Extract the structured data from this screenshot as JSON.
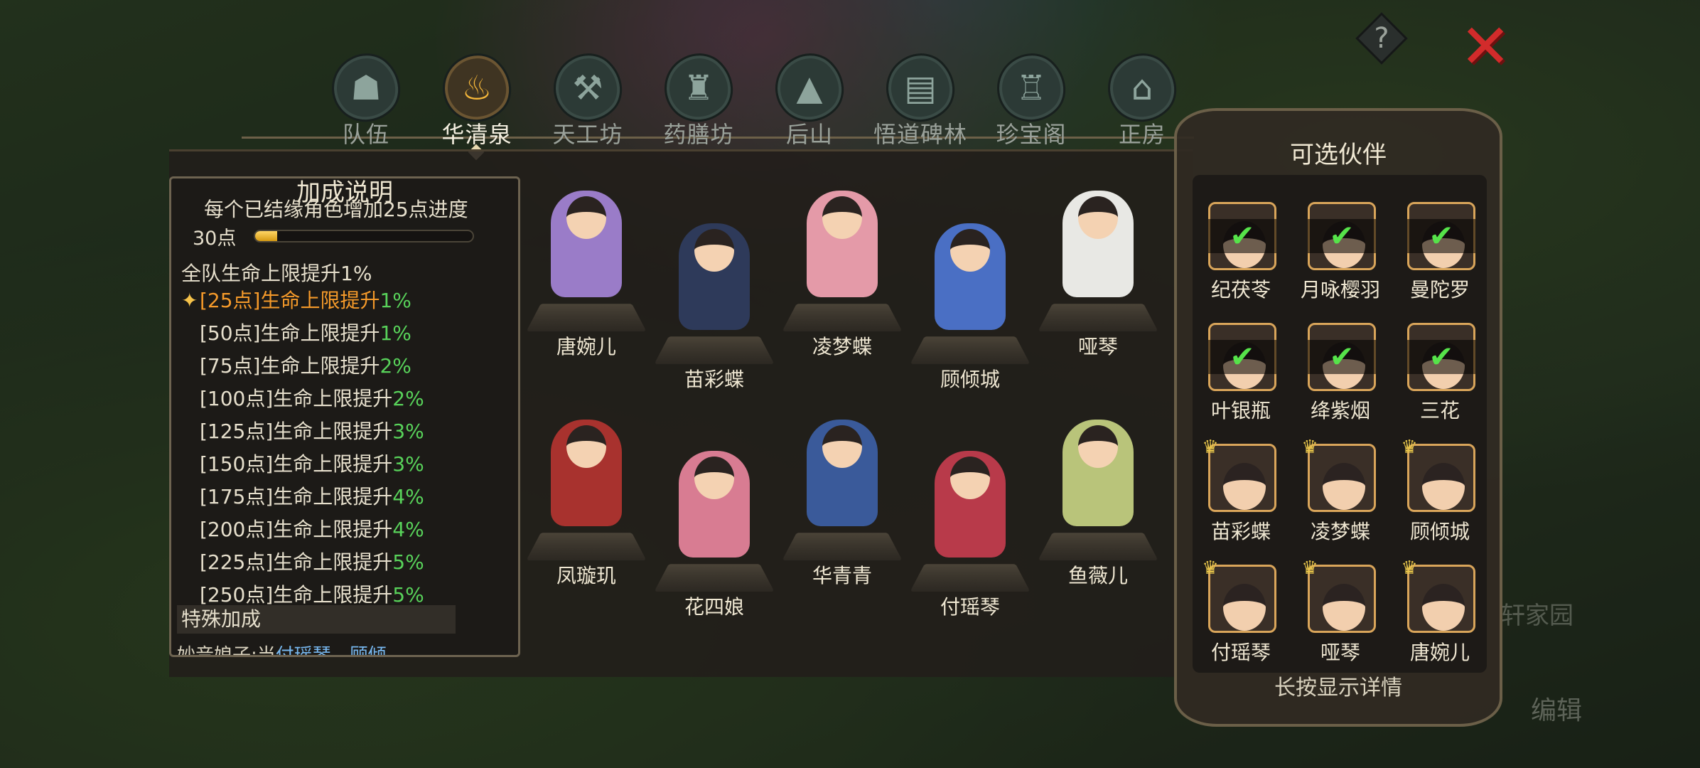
{
  "tabs": [
    {
      "label": "队伍",
      "glyph": "☗",
      "icon": "team-icon"
    },
    {
      "label": "华清泉",
      "glyph": "♨",
      "icon": "hot-spring-icon"
    },
    {
      "label": "天工坊",
      "glyph": "⚒",
      "icon": "workshop-icon"
    },
    {
      "label": "药膳坊",
      "glyph": "♜",
      "icon": "kitchen-icon"
    },
    {
      "label": "后山",
      "glyph": "▲",
      "icon": "mountain-icon"
    },
    {
      "label": "悟道碑林",
      "glyph": "▤",
      "icon": "stele-icon"
    },
    {
      "label": "珍宝阁",
      "glyph": "♖",
      "icon": "treasure-pavilion-icon"
    },
    {
      "label": "正房",
      "glyph": "⌂",
      "icon": "main-house-icon"
    }
  ],
  "active_tab": "华清泉",
  "help_glyph": "?",
  "close_glyph": "✕",
  "info": {
    "title": "加成说明",
    "description": "每个已结缘角色增加25点进度",
    "progress_label": "30点",
    "progress_fraction": 0.1,
    "team_bonus": "全队生命上限提升1%",
    "bonuses": [
      {
        "text": "[25点]生命上限提升",
        "pct": "1%",
        "active": true
      },
      {
        "text": "[50点]生命上限提升",
        "pct": "1%",
        "active": false
      },
      {
        "text": "[75点]生命上限提升",
        "pct": "2%",
        "active": false
      },
      {
        "text": "[100点]生命上限提升",
        "pct": "2%",
        "active": false
      },
      {
        "text": "[125点]生命上限提升",
        "pct": "3%",
        "active": false
      },
      {
        "text": "[150点]生命上限提升",
        "pct": "3%",
        "active": false
      },
      {
        "text": "[175点]生命上限提升",
        "pct": "4%",
        "active": false
      },
      {
        "text": "[200点]生命上限提升",
        "pct": "4%",
        "active": false
      },
      {
        "text": "[225点]生命上限提升",
        "pct": "5%",
        "active": false
      },
      {
        "text": "[250点]生命上限提升",
        "pct": "5%",
        "active": false
      }
    ],
    "special_title": "特殊加成",
    "special_text_a": "妙音娘子:当",
    "special_text_hl": "付瑶琴、顾倾",
    "star_glyph": "✦"
  },
  "characters": [
    {
      "name": "唐婉儿",
      "robe": "#9a7cc8"
    },
    {
      "name": "苗彩蝶",
      "robe": "#2e3a5a"
    },
    {
      "name": "凌梦蝶",
      "robe": "#e49aa8"
    },
    {
      "name": "顾倾城",
      "robe": "#4a6fc4"
    },
    {
      "name": "哑琴",
      "robe": "#e8e8e4"
    },
    {
      "name": "凤璇玑",
      "robe": "#a8322e"
    },
    {
      "name": "花四娘",
      "robe": "#d87c92"
    },
    {
      "name": "华青青",
      "robe": "#3a5a9a"
    },
    {
      "name": "付瑶琴",
      "robe": "#b83a4a"
    },
    {
      "name": "鱼薇儿",
      "robe": "#b9c47a"
    }
  ],
  "partners": {
    "title": "可选伙伴",
    "hint": "长按显示详情",
    "check_glyph": "✔",
    "crown_glyph": "♛",
    "items": [
      {
        "name": "纪茯苓",
        "selected": true,
        "crown": false
      },
      {
        "name": "月咏樱羽",
        "selected": true,
        "crown": false
      },
      {
        "name": "曼陀罗",
        "selected": true,
        "crown": false
      },
      {
        "name": "叶银瓶",
        "selected": true,
        "crown": false
      },
      {
        "name": "绛紫烟",
        "selected": true,
        "crown": false
      },
      {
        "name": "三花",
        "selected": true,
        "crown": false
      },
      {
        "name": "苗彩蝶",
        "selected": false,
        "crown": true
      },
      {
        "name": "凌梦蝶",
        "selected": false,
        "crown": true
      },
      {
        "name": "顾倾城",
        "selected": false,
        "crown": true
      },
      {
        "name": "付瑶琴",
        "selected": false,
        "crown": true
      },
      {
        "name": "哑琴",
        "selected": false,
        "crown": true
      },
      {
        "name": "唐婉儿",
        "selected": false,
        "crown": true
      }
    ]
  },
  "background": {
    "edit_label": "编辑",
    "garden_label": "轩家园"
  }
}
